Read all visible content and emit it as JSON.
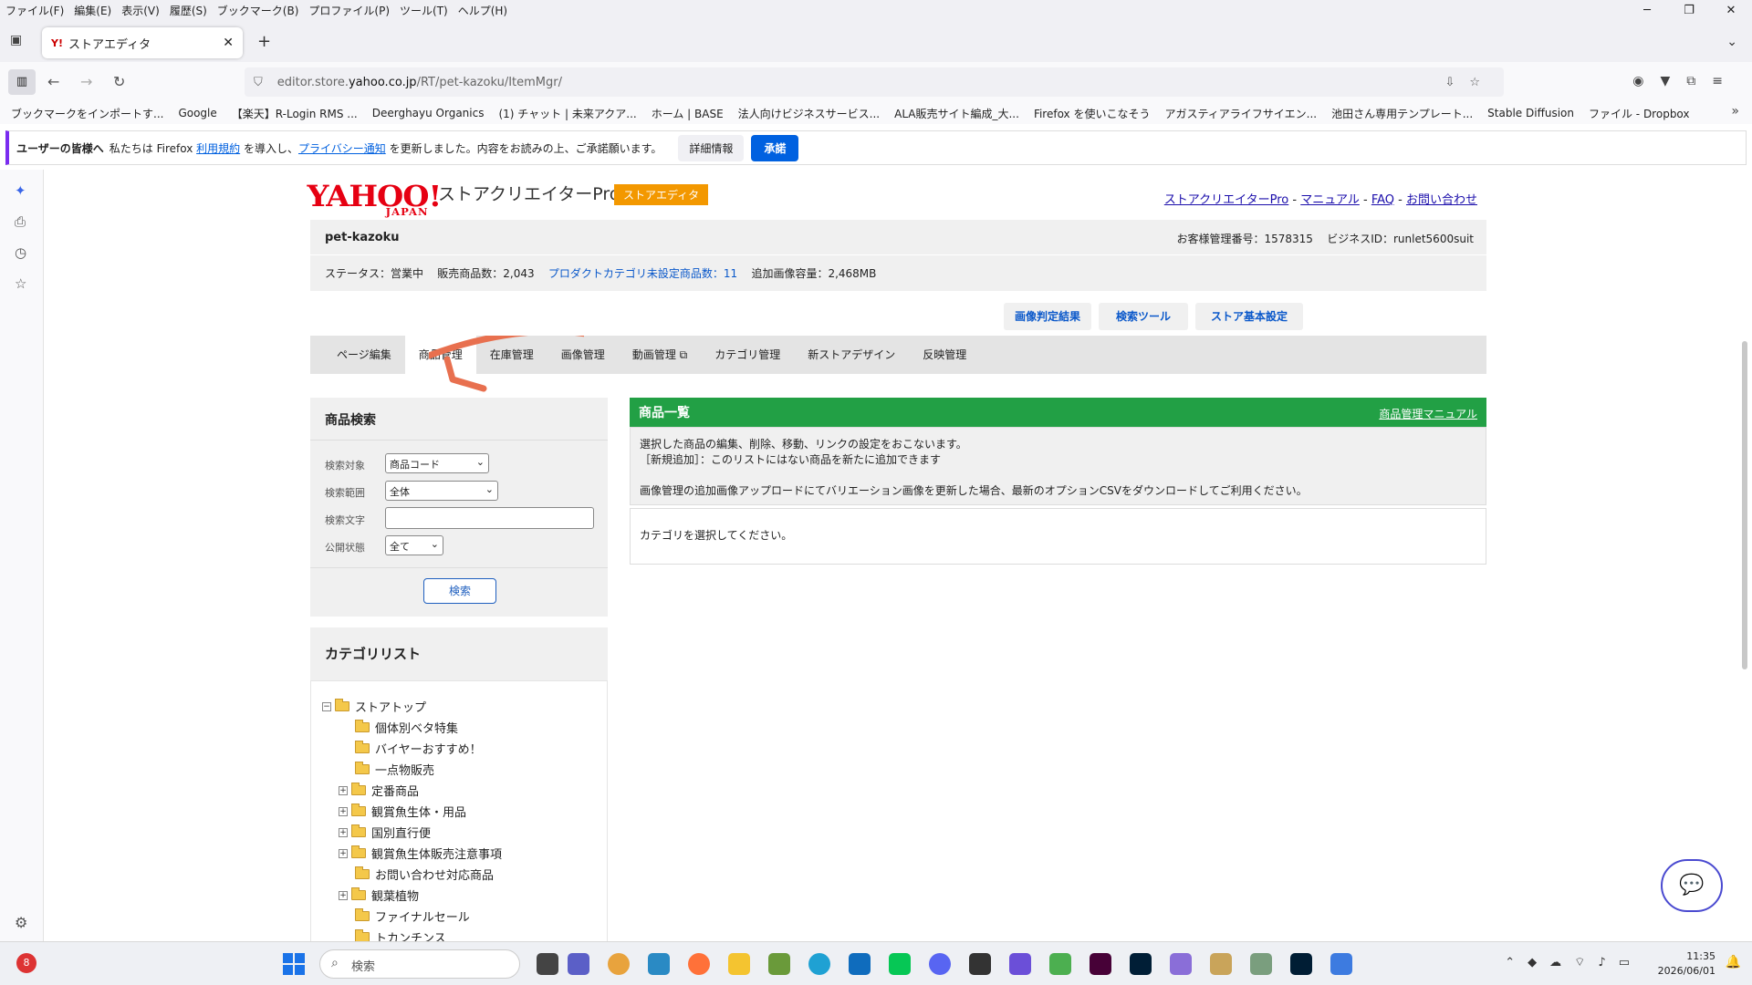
{
  "menu": [
    "ファイル(F)",
    "編集(E)",
    "表示(V)",
    "履歴(S)",
    "ブックマーク(B)",
    "プロファイル(P)",
    "ツール(T)",
    "ヘルプ(H)"
  ],
  "tab": {
    "title": "ストアエディタ",
    "favicon": "Y!"
  },
  "url": {
    "prefix": "editor.store.",
    "domain": "yahoo.co.jp",
    "path": "/RT/pet-kazoku/ItemMgr/"
  },
  "bookmarks": [
    "ブックマークをインポートす...",
    "Google",
    "【楽天】R-Login RMS ...",
    "Deerghayu Organics",
    "(1) チャット | 未来アクア...",
    "ホーム | BASE",
    "法人向けビジネスサービス...",
    "ALA販売サイト編成_大...",
    "Firefox を使いこなそう",
    "アガスティアライフサイエン...",
    "池田さん専用テンプレート...",
    "Stable Diffusion",
    "ファイル - Dropbox"
  ],
  "notification": {
    "lead": "ユーザーの皆様へ",
    "text1": "私たちは Firefox",
    "link1": "利用規約",
    "text2": "を導入し、",
    "link2": "プライバシー通知",
    "text3": "を更新しました。内容をお読みの上、ご承諾願います。",
    "detail_btn": "詳細情報",
    "accept_btn": "承諾"
  },
  "header": {
    "logo": "YAHOO!",
    "logo_sub": "JAPAN",
    "product": "ストアクリエイターPro",
    "badge": "ストアエディタ",
    "links": [
      "ストアクリエイターPro",
      "マニュアル",
      "FAQ",
      "お問い合わせ"
    ]
  },
  "store": {
    "name": "pet-kazoku",
    "customer_no": "お客様管理番号：1578315",
    "business_id": "ビジネスID：runlet5600suit",
    "status": "ステータス：営業中",
    "sales_items": "販売商品数：2,043",
    "unset_category": "プロダクトカテゴリ未設定商品数：11",
    "image_capacity": "追加画像容量：2,468MB"
  },
  "top_buttons": [
    "画像判定結果",
    "検索ツール",
    "ストア基本設定"
  ],
  "tabs": [
    "ページ編集",
    "商品管理",
    "在庫管理",
    "画像管理",
    "動画管理",
    "カテゴリ管理",
    "新ストアデザイン",
    "反映管理"
  ],
  "search": {
    "title": "商品検索",
    "target_label": "検索対象",
    "target_value": "商品コード",
    "range_label": "検索範囲",
    "range_value": "全体",
    "text_label": "検索文字",
    "text_value": "",
    "public_label": "公開状態",
    "public_value": "全て",
    "button": "検索"
  },
  "category": {
    "title": "カテゴリリスト",
    "root": "ストアトップ",
    "items": [
      "個体別ベタ特集",
      "バイヤーおすすめ！",
      "一点物販売",
      "定番商品",
      "観賞魚生体・用品",
      "国別直行便",
      "観賞魚生体販売注意事項",
      "お問い合わせ対応商品",
      "観葉植物",
      "ファイナルセール",
      "トカンチンス"
    ]
  },
  "list": {
    "title": "商品一覧",
    "manual_link": "商品管理マニュアル",
    "desc1": "選択した商品の編集、削除、移動、リンクの設定をおこないます。",
    "desc2": "［新規追加］：このリストにはない商品を新たに追加できます",
    "desc3": "画像管理の追加画像アップロードにてバリエーション画像を更新した場合、最新のオプションCSVをダウンロードしてご利用ください。",
    "empty": "カテゴリを選択してください。"
  },
  "taskbar": {
    "search": "検索",
    "weather_badge": "8",
    "time": "11:35",
    "date": "2026/06/01"
  }
}
